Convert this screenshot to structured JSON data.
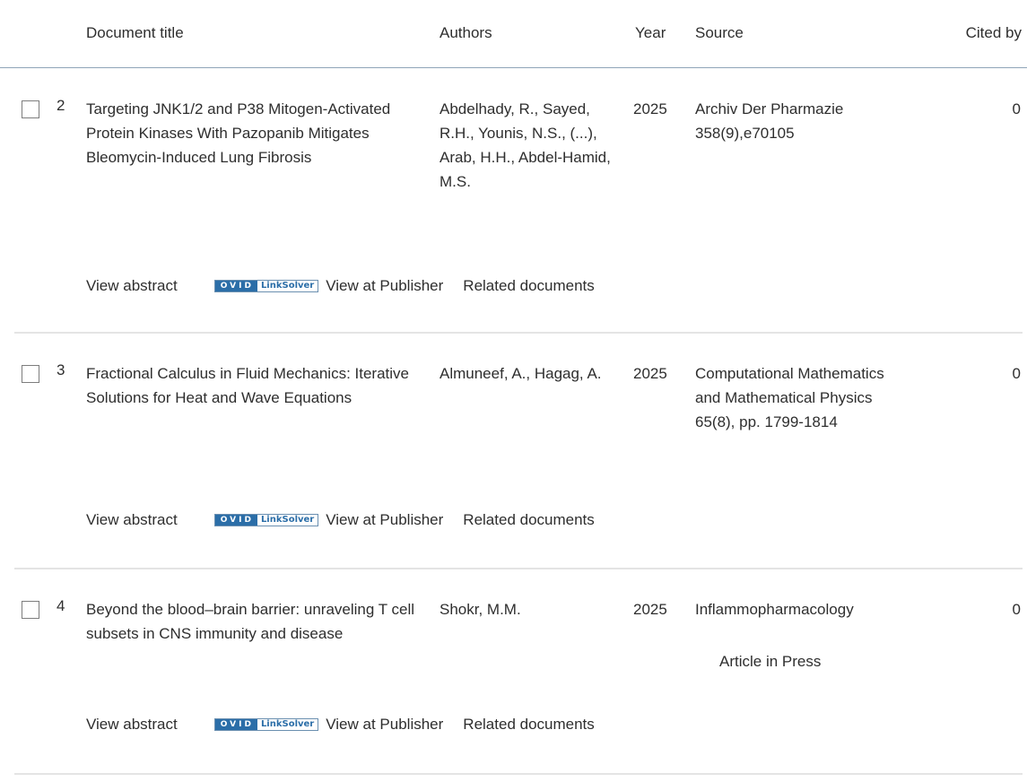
{
  "header": {
    "title": "Document title",
    "authors": "Authors",
    "year": "Year",
    "source": "Source",
    "cited_by": "Cited by"
  },
  "ovid": {
    "left": "OVID",
    "right": "LinkSolver"
  },
  "rows": [
    {
      "num": "2",
      "title": "Targeting JNK1/2 and P38 Mitogen-Activated Protein Kinases With Pazopanib Mitigates Bleomycin-Induced Lung Fibrosis",
      "authors": "Abdelhady, R., Sayed, R.H., Younis, N.S., (...), Arab, H.H., Abdel-Hamid, M.S.",
      "year": "2025",
      "source": "Archiv Der Pharmazie 358(9),e70105",
      "cited": "0",
      "view_abstract": "View abstract",
      "view_publisher": "View at Publisher",
      "related": "Related documents"
    },
    {
      "num": "3",
      "title": "Fractional Calculus in Fluid Mechanics: Iterative Solutions for Heat and Wave Equations",
      "authors": "Almuneef, A., Hagag, A.",
      "year": "2025",
      "source": "Computational Mathematics and Mathematical Physics 65(8), pp. 1799-1814",
      "cited": "0",
      "view_abstract": "View abstract",
      "view_publisher": "View at Publisher",
      "related": "Related documents"
    },
    {
      "num": "4",
      "title": "Beyond the blood–brain barrier: unraveling T cell subsets in CNS immunity and disease",
      "authors": "Shokr, M.M.",
      "year": "2025",
      "source": "Inflammopharmacology",
      "status": "Article in Press",
      "cited": "0",
      "view_abstract": "View abstract",
      "view_publisher": "View at Publisher",
      "related": "Related documents"
    }
  ]
}
